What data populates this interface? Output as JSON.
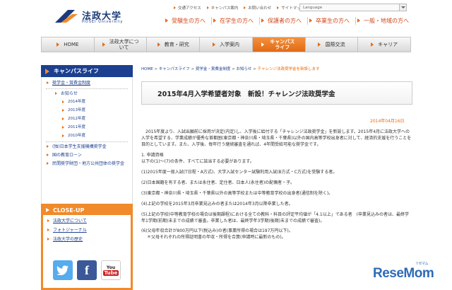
{
  "header": {
    "logo_jp": "法政大学",
    "logo_en": "HOSEI University",
    "util_links": [
      "交通アクセス",
      "キャンパス案内",
      "お問い合わせ",
      "サイトマップ"
    ],
    "language_label": "Language",
    "audience_links": [
      "受験生の方へ",
      "在学生の方へ",
      "保護者の方へ",
      "卒業生の方へ",
      "一般・地域の方へ"
    ]
  },
  "nav": {
    "items": [
      "HOME",
      "法政大学について",
      "教育・研究",
      "入学案内",
      "キャンパスライフ",
      "国際交流",
      "キャリア"
    ],
    "active_index": 4
  },
  "sidebar": {
    "title": "キャンパスライフ",
    "main_link": "奨学金・賞費金制度",
    "notice": "お知らせ",
    "years": [
      "2014年度",
      "2013年度",
      "2012年度",
      "2011年度",
      "2010年度"
    ],
    "links": [
      "(独)日本学生支援機構奨学金",
      "国の教育ローン",
      "民間奨学財団・地方公共団体の奨学金"
    ]
  },
  "closeup": {
    "title": "CLOSE-UP",
    "links": [
      "法政大学について",
      "フォトジャーナル",
      "法政大学の歴史"
    ],
    "sns": [
      "twitter",
      "f",
      "You",
      "Tube"
    ]
  },
  "breadcrumb": {
    "items": [
      "HOME",
      "キャンパスライフ",
      "奨学金・賞費金制度",
      "お知らせ"
    ],
    "separator": ">",
    "current": "チャレンジ法政奨学金を新設します"
  },
  "article": {
    "title": "2015年4月入学希望者対象　新設！チャレンジ法政奨学金",
    "date": "2014年04月16日",
    "intro": "2015年度より、入試出願前に採用が決定(内定)し、入学後に給付する「チャレンジ法政奨学金」を新設します。2015年4月に法政大学への入学を希望する、学業成績が優秀な首都圏(東京都・神奈川県・埼玉県・千葉県)以外の国内高等学校出身者に対して、経済的支援を行うことを目的としています。また、入学後、毎年行う継続審査を通れば、4年間受給可能な奨学金です。",
    "section_title": "1. 申請資格",
    "section_lead": "以下の(1)〜(7)の条件、すべてに該当する必要があります。",
    "items": [
      "(1)2015年度一般入試(T日程・A方式)、大学入試センター試験利用入試(B方式・C方式)を受験する者。",
      "(2)日本国籍を有する者、または永住者、定住者、日本人(永住者)の配偶者・子。",
      "(3)東京都・神奈川県・埼玉県・千葉県以外の高等学校または中等教育学校の出身者(通信制を除く)。",
      "(4)上記の学校を2015年3月卒業見込みの者または2014年3月以降卒業した者。",
      "(5)上記の学校(中等教育学校の場合は後期課程)における全ての教科・科目の評定平均値が「4.1以上」である者　(卒業見込みの者は、最終学年1学期(前期)末までの成績で審査。卒業した者は、最終学年3学期(後期)末までの成績で審査)。",
      "(6)父母年収合計が800万円以下(税込み)の者(事業所得の場合は197万円以下)。",
      "＊父母それぞれの所得証明書の年収・所得を合算(申請時に最新のもの)。"
    ]
  },
  "watermark": {
    "text": "ReseMom",
    "sub": "リセマム"
  }
}
